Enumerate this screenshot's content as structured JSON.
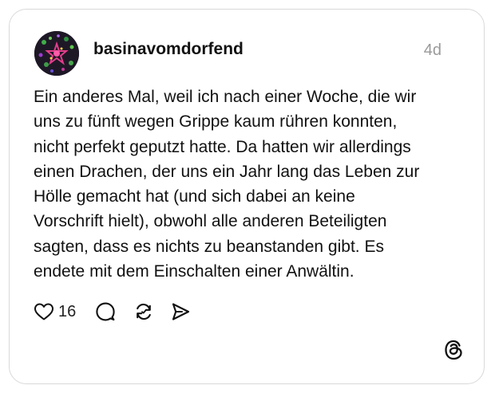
{
  "post": {
    "username": "basinavomdorfend",
    "timestamp": "4d",
    "body_lines": [
      "Ein anderes Mal, weil ich nach einer Woche, die wir",
      "uns zu fünft wegen Grippe kaum rühren konnten,",
      "nicht perfekt geputzt hatte. Da hatten wir allerdings",
      "einen Drachen, der uns ein Jahr lang das Leben zur",
      "Hölle gemacht hat (und sich dabei an keine",
      "Vorschrift hielt), obwohl alle anderen Beteiligten",
      "sagten, dass es nichts zu beanstanden gibt. Es",
      "endete mit dem Einschalten einer Anwältin."
    ],
    "like_count": "16"
  },
  "icons": {
    "like": "heart-icon",
    "reply": "comment-bubble-icon",
    "repost": "repost-arrows-icon",
    "share": "send-paper-plane-icon",
    "brand": "threads-logo-icon"
  },
  "colors": {
    "text": "#111111",
    "muted": "#9a9a9a",
    "border": "#d9d9d9",
    "background": "#ffffff"
  }
}
